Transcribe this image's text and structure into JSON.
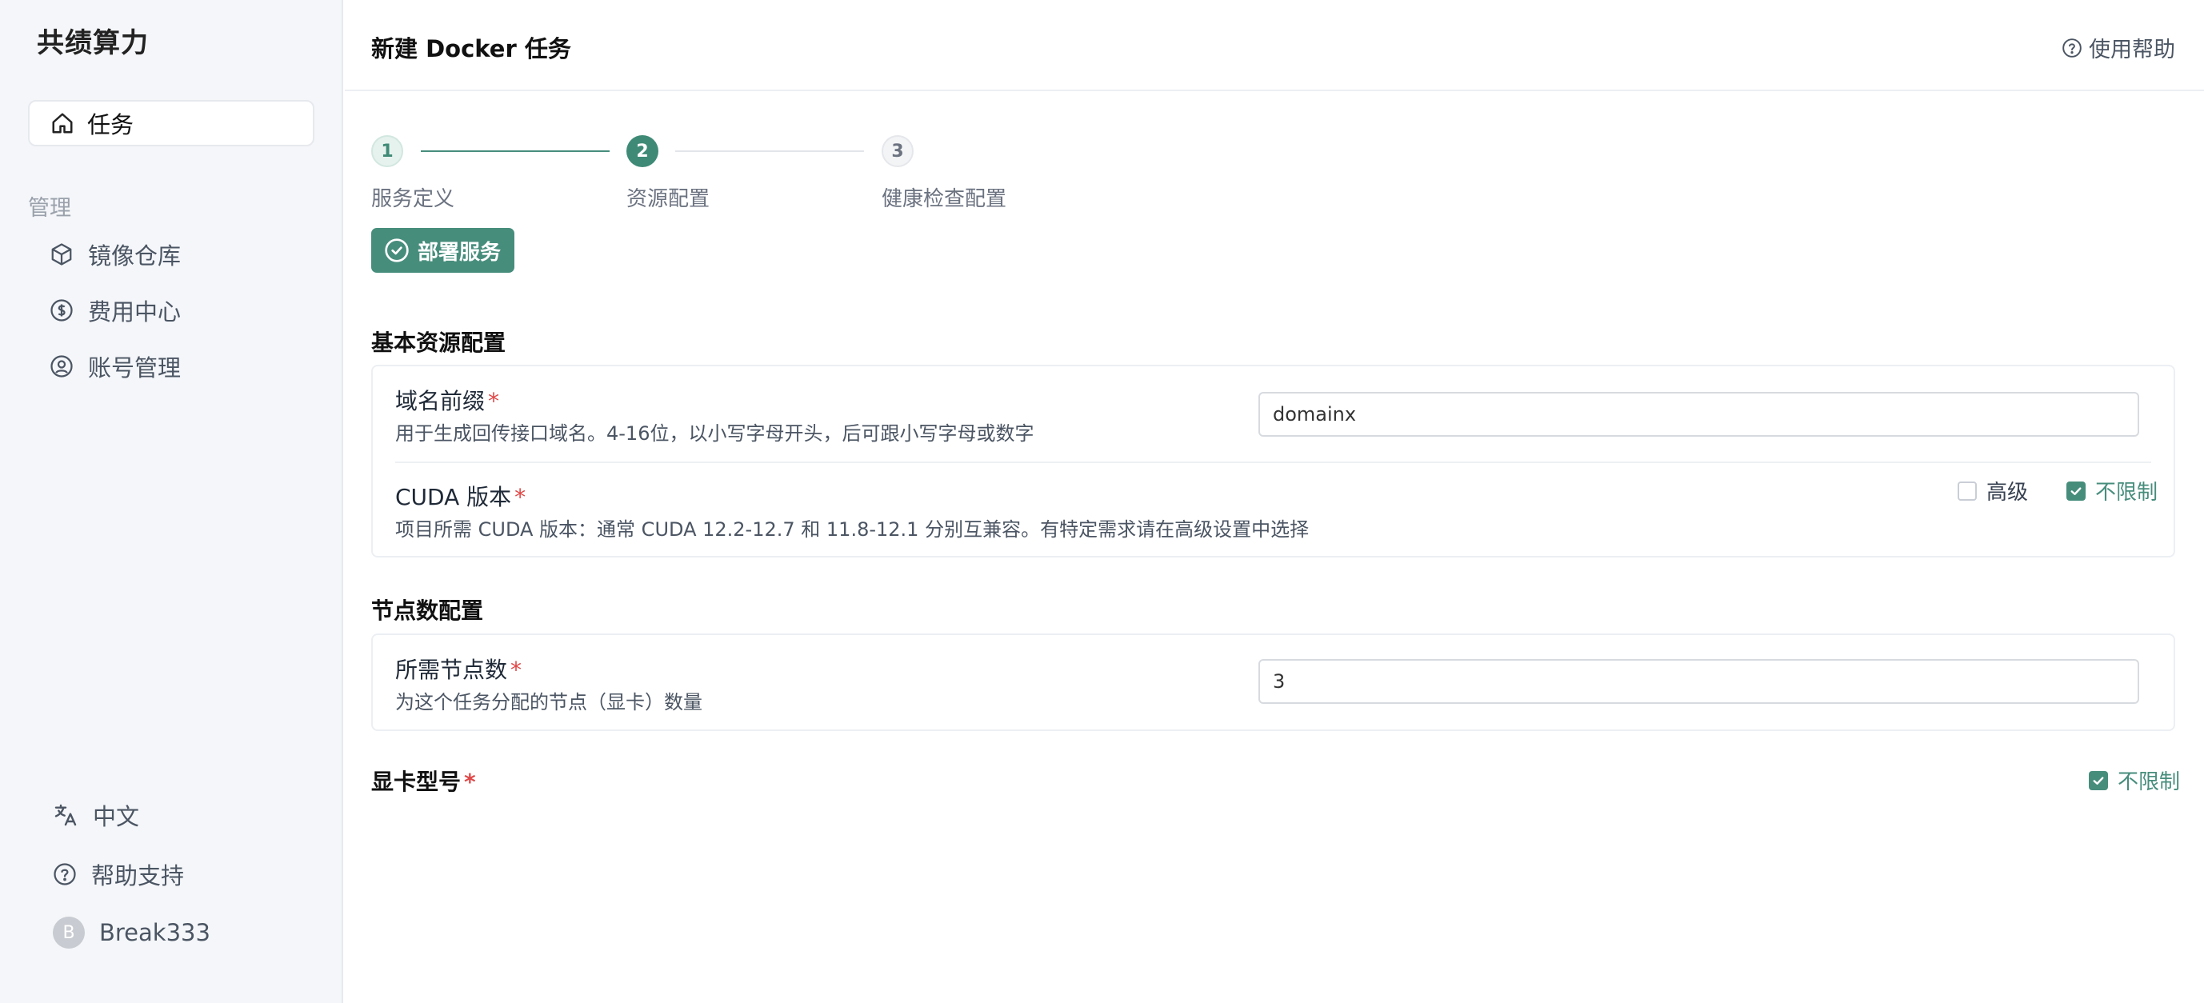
{
  "sidebar": {
    "brand": "共绩算力",
    "active_item": "任务",
    "section_title": "管理",
    "items": [
      {
        "label": "镜像仓库",
        "icon": "cube-icon"
      },
      {
        "label": "费用中心",
        "icon": "dollar-icon"
      },
      {
        "label": "账号管理",
        "icon": "user-circle-icon"
      }
    ],
    "bottom": {
      "language": "中文",
      "help": "帮助支持",
      "user": "Break333",
      "avatar_initial": "B"
    }
  },
  "header": {
    "title": "新建 Docker 任务",
    "help": "使用帮助"
  },
  "steps": [
    {
      "number": "1",
      "label": "服务定义",
      "state": "done"
    },
    {
      "number": "2",
      "label": "资源配置",
      "state": "active"
    },
    {
      "number": "3",
      "label": "健康检查配置",
      "state": "pending"
    }
  ],
  "deploy_button": "部署服务",
  "basic_section": {
    "title": "基本资源配置",
    "domain": {
      "label": "域名前缀",
      "required": "*",
      "description": "用于生成回传接口域名。4-16位，以小写字母开头，后可跟小写字母或数字",
      "value": "domainx"
    },
    "cuda": {
      "label": "CUDA 版本",
      "required": "*",
      "description": "项目所需 CUDA 版本：通常 CUDA 12.2-12.7 和 11.8-12.1 分别互兼容。有特定需求请在高级设置中选择",
      "advanced_label": "高级",
      "advanced_checked": false,
      "unlimited_label": "不限制",
      "unlimited_checked": true
    }
  },
  "node_section": {
    "title": "节点数配置",
    "nodes": {
      "label": "所需节点数",
      "required": "*",
      "description": "为这个任务分配的节点（显卡）数量",
      "value": "3"
    }
  },
  "gpu_section": {
    "title": "显卡型号",
    "required": "*",
    "unlimited_label": "不限制",
    "unlimited_checked": true
  },
  "colors": {
    "accent": "#478d7c",
    "required": "#e04848",
    "sidebar_bg": "#f4f6f9"
  }
}
